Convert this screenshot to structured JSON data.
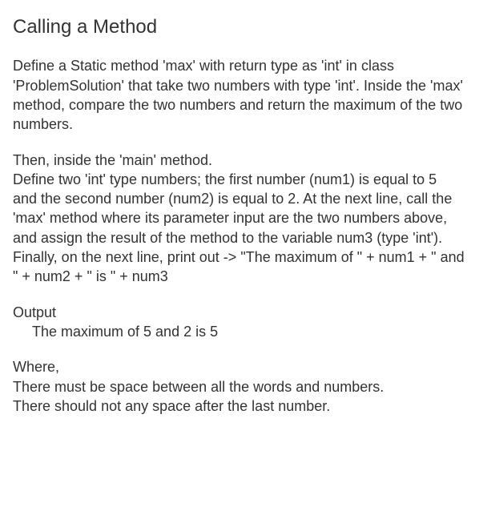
{
  "heading": "Calling a Method",
  "para1": "Define a Static method 'max' with return type as 'int' in class 'ProblemSolution' that take two numbers with type 'int'. Inside the 'max' method, compare the two numbers and return the maximum of the two numbers.",
  "para2": "Then, inside the 'main' method.\nDefine two 'int' type numbers; the first number (num1) is equal to 5 and the second number (num2) is equal to 2. At the next line, call the 'max' method where its parameter input are the two numbers above, and assign the result of the method to the variable num3 (type 'int'). Finally, on the next line, print out -> \"The maximum of \" + num1 + \" and \" + num2 + \" is \" + num3",
  "output": {
    "label": "Output",
    "content": "The maximum of 5 and 2 is 5"
  },
  "where": {
    "label": "Where,",
    "line1": "There must be space between all the words and numbers.",
    "line2": "There should not any space after the last number."
  }
}
